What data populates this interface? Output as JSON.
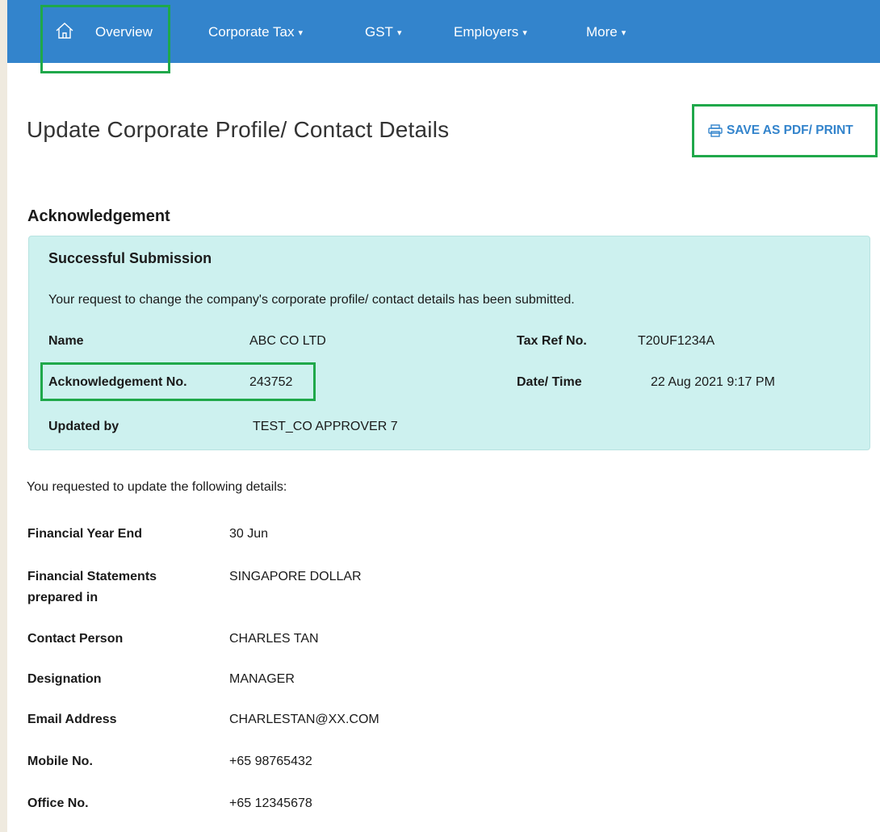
{
  "nav": {
    "home_icon": "home-icon",
    "items": [
      {
        "label": "Overview"
      },
      {
        "label": "Corporate Tax",
        "caret": "▾"
      },
      {
        "label": "GST",
        "caret": "▾"
      },
      {
        "label": "Employers",
        "caret": "▾"
      },
      {
        "label": "More",
        "caret": "▾"
      }
    ]
  },
  "page": {
    "title": "Update Corporate Profile/ Contact Details",
    "print_label": "SAVE AS PDF/ PRINT",
    "print_icon": "printer-icon",
    "section_title": "Acknowledgement"
  },
  "ack": {
    "title": "Successful Submission",
    "message": "Your request to change the company's corporate profile/ contact details has been submitted.",
    "name_label": "Name",
    "name_value": "ABC CO LTD",
    "taxref_label": "Tax Ref No.",
    "taxref_value": "T20UF1234A",
    "ackno_label": "Acknowledgement No.",
    "ackno_value": "243752",
    "datetime_label": "Date/ Time",
    "datetime_value": "22 Aug 2021 9:17 PM",
    "updatedby_label": "Updated by",
    "updatedby_value": "TEST_CO APPROVER 7"
  },
  "details": {
    "intro": "You requested to update the following details:",
    "rows": [
      {
        "label": "Financial Year End",
        "value": "30 Jun"
      },
      {
        "label": "Financial Statements",
        "label2": "prepared in",
        "value": "SINGAPORE DOLLAR"
      },
      {
        "label": "Contact Person",
        "value": "CHARLES TAN"
      },
      {
        "label": "Designation",
        "value": "MANAGER"
      },
      {
        "label": "Email Address",
        "value": "CHARLESTAN@XX.COM"
      },
      {
        "label": "Mobile No.",
        "value": "+65 98765432"
      },
      {
        "label": "Office No.",
        "value": "+65 12345678"
      }
    ]
  },
  "colors": {
    "nav_bg": "#3384cc",
    "accent_link": "#3384cc",
    "ack_bg": "#cdf1ef",
    "highlight": "#1fa84a"
  }
}
